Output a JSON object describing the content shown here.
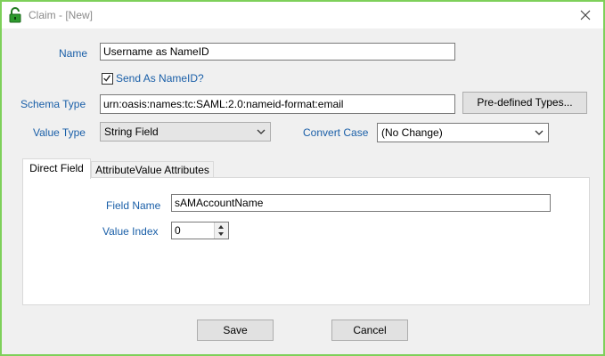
{
  "window": {
    "title": "Claim - [New]",
    "icons": {
      "app": "lock-icon",
      "close": "close-icon"
    },
    "border_color": "#7ed05a"
  },
  "form": {
    "name": {
      "label": "Name",
      "value": "Username as NameID"
    },
    "send_as_nameid": {
      "label": "Send As NameID?",
      "checked": true
    },
    "schema_type": {
      "label": "Schema Type",
      "value": "urn:oasis:names:tc:SAML:2.0:nameid-format:email"
    },
    "predefined_button": "Pre-defined Types...",
    "value_type": {
      "label": "Value Type",
      "selected": "String Field"
    },
    "convert_case": {
      "label": "Convert Case",
      "selected": "(No Change)"
    }
  },
  "tabs": [
    {
      "label": "Direct Field",
      "active": true
    },
    {
      "label": "AttributeValue Attributes",
      "active": false
    }
  ],
  "direct_field": {
    "field_name": {
      "label": "Field Name",
      "value": "sAMAccountName"
    },
    "value_index": {
      "label": "Value Index",
      "value": "0"
    }
  },
  "buttons": {
    "save": "Save",
    "cancel": "Cancel"
  },
  "colors": {
    "label": "#1a5fa8",
    "window_bg": "#f0f0f0"
  }
}
